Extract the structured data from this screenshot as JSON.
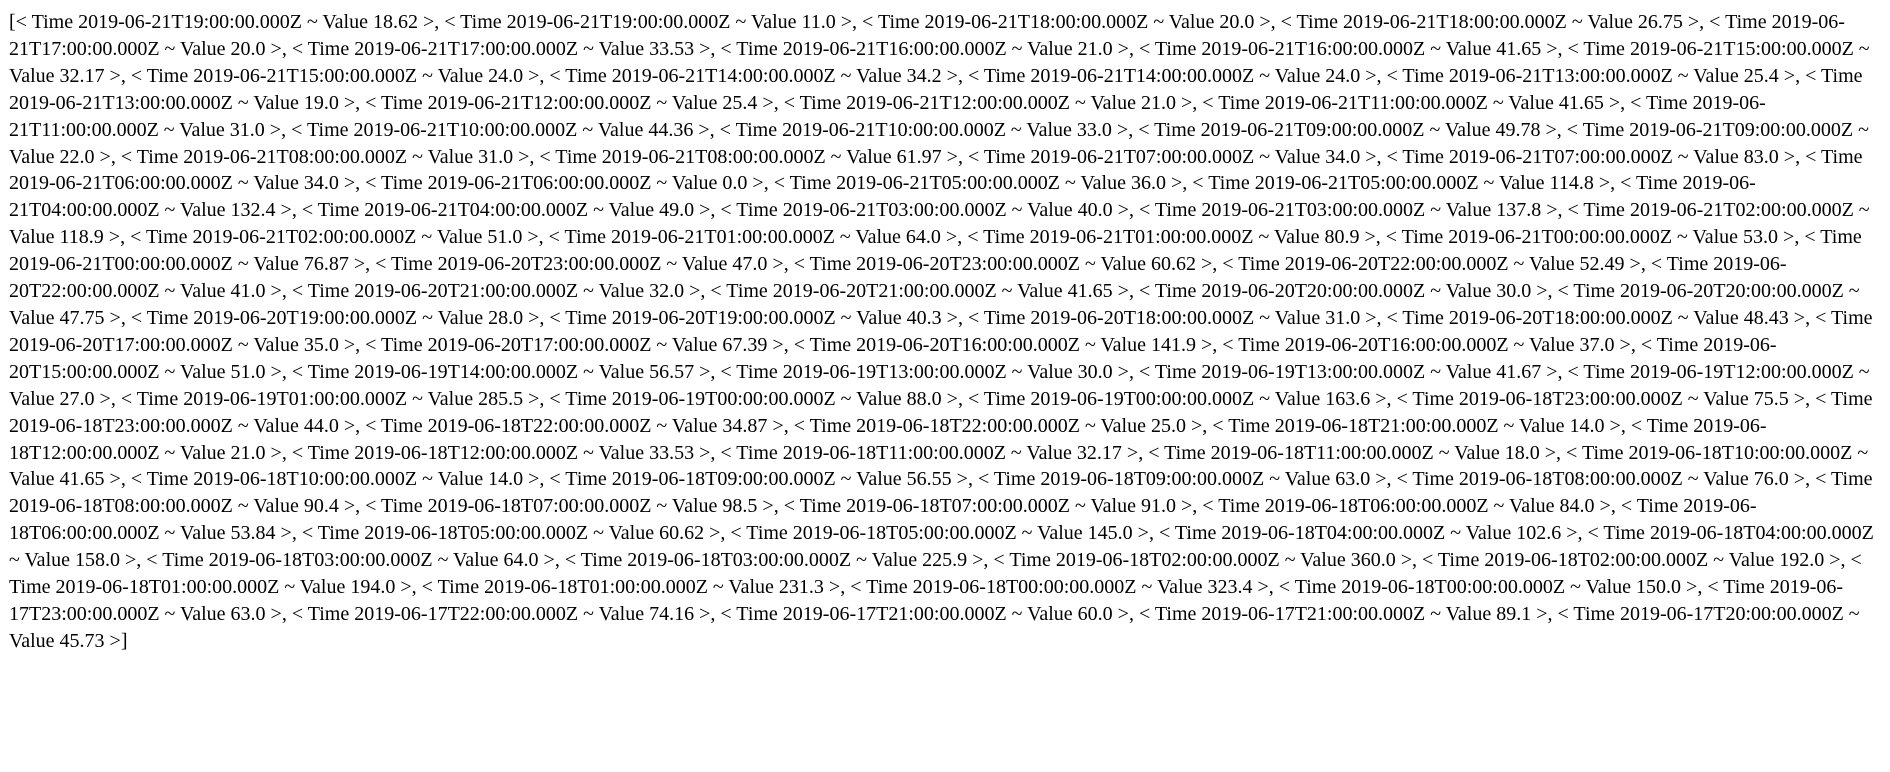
{
  "document": {
    "content": "[< Time 2019-06-21T19:00:00.000Z ~ Value 18.62 >, < Time 2019-06-21T19:00:00.000Z ~ Value 11.0 >, < Time 2019-06-21T18:00:00.000Z ~ Value 20.0 >, < Time 2019-06-21T18:00:00.000Z ~ Value 26.75 >, < Time 2019-06-21T17:00:00.000Z ~ Value 20.0 >, < Time 2019-06-21T17:00:00.000Z ~ Value 33.53 >, < Time 2019-06-21T16:00:00.000Z ~ Value 21.0 >, < Time 2019-06-21T16:00:00.000Z ~ Value 41.65 >, < Time 2019-06-21T15:00:00.000Z ~ Value 32.17 >, < Time 2019-06-21T15:00:00.000Z ~ Value 24.0 >, < Time 2019-06-21T14:00:00.000Z ~ Value 34.2 >, < Time 2019-06-21T14:00:00.000Z ~ Value 24.0 >, < Time 2019-06-21T13:00:00.000Z ~ Value 25.4 >, < Time 2019-06-21T13:00:00.000Z ~ Value 19.0 >, < Time 2019-06-21T12:00:00.000Z ~ Value 25.4 >, < Time 2019-06-21T12:00:00.000Z ~ Value 21.0 >, < Time 2019-06-21T11:00:00.000Z ~ Value 41.65 >, < Time 2019-06-21T11:00:00.000Z ~ Value 31.0 >, < Time 2019-06-21T10:00:00.000Z ~ Value 44.36 >, < Time 2019-06-21T10:00:00.000Z ~ Value 33.0 >, < Time 2019-06-21T09:00:00.000Z ~ Value 49.78 >, < Time 2019-06-21T09:00:00.000Z ~ Value 22.0 >, < Time 2019-06-21T08:00:00.000Z ~ Value 31.0 >, < Time 2019-06-21T08:00:00.000Z ~ Value 61.97 >, < Time 2019-06-21T07:00:00.000Z ~ Value 34.0 >, < Time 2019-06-21T07:00:00.000Z ~ Value 83.0 >, < Time 2019-06-21T06:00:00.000Z ~ Value 34.0 >, < Time 2019-06-21T06:00:00.000Z ~ Value 0.0 >, < Time 2019-06-21T05:00:00.000Z ~ Value 36.0 >, < Time 2019-06-21T05:00:00.000Z ~ Value 114.8 >, < Time 2019-06-21T04:00:00.000Z ~ Value 132.4 >, < Time 2019-06-21T04:00:00.000Z ~ Value 49.0 >, < Time 2019-06-21T03:00:00.000Z ~ Value 40.0 >, < Time 2019-06-21T03:00:00.000Z ~ Value 137.8 >, < Time 2019-06-21T02:00:00.000Z ~ Value 118.9 >, < Time 2019-06-21T02:00:00.000Z ~ Value 51.0 >, < Time 2019-06-21T01:00:00.000Z ~ Value 64.0 >, < Time 2019-06-21T01:00:00.000Z ~ Value 80.9 >, < Time 2019-06-21T00:00:00.000Z ~ Value 53.0 >, < Time 2019-06-21T00:00:00.000Z ~ Value 76.87 >, < Time 2019-06-20T23:00:00.000Z ~ Value 47.0 >, < Time 2019-06-20T23:00:00.000Z ~ Value 60.62 >, < Time 2019-06-20T22:00:00.000Z ~ Value 52.49 >, < Time 2019-06-20T22:00:00.000Z ~ Value 41.0 >, < Time 2019-06-20T21:00:00.000Z ~ Value 32.0 >, < Time 2019-06-20T21:00:00.000Z ~ Value 41.65 >, < Time 2019-06-20T20:00:00.000Z ~ Value 30.0 >, < Time 2019-06-20T20:00:00.000Z ~ Value 47.75 >, < Time 2019-06-20T19:00:00.000Z ~ Value 28.0 >, < Time 2019-06-20T19:00:00.000Z ~ Value 40.3 >, < Time 2019-06-20T18:00:00.000Z ~ Value 31.0 >, < Time 2019-06-20T18:00:00.000Z ~ Value 48.43 >, < Time 2019-06-20T17:00:00.000Z ~ Value 35.0 >, < Time 2019-06-20T17:00:00.000Z ~ Value 67.39 >, < Time 2019-06-20T16:00:00.000Z ~ Value 141.9 >, < Time 2019-06-20T16:00:00.000Z ~ Value 37.0 >, < Time 2019-06-20T15:00:00.000Z ~ Value 51.0 >, < Time 2019-06-19T14:00:00.000Z ~ Value 56.57 >, < Time 2019-06-19T13:00:00.000Z ~ Value 30.0 >, < Time 2019-06-19T13:00:00.000Z ~ Value 41.67 >, < Time 2019-06-19T12:00:00.000Z ~ Value 27.0 >, < Time 2019-06-19T01:00:00.000Z ~ Value 285.5 >, < Time 2019-06-19T00:00:00.000Z ~ Value 88.0 >, < Time 2019-06-19T00:00:00.000Z ~ Value 163.6 >, < Time 2019-06-18T23:00:00.000Z ~ Value 75.5 >, < Time 2019-06-18T23:00:00.000Z ~ Value 44.0 >, < Time 2019-06-18T22:00:00.000Z ~ Value 34.87 >, < Time 2019-06-18T22:00:00.000Z ~ Value 25.0 >, < Time 2019-06-18T21:00:00.000Z ~ Value 14.0 >, < Time 2019-06-18T12:00:00.000Z ~ Value 21.0 >, < Time 2019-06-18T12:00:00.000Z ~ Value 33.53 >, < Time 2019-06-18T11:00:00.000Z ~ Value 32.17 >, < Time 2019-06-18T11:00:00.000Z ~ Value 18.0 >, < Time 2019-06-18T10:00:00.000Z ~ Value 41.65 >, < Time 2019-06-18T10:00:00.000Z ~ Value 14.0 >, < Time 2019-06-18T09:00:00.000Z ~ Value 56.55 >, < Time 2019-06-18T09:00:00.000Z ~ Value 63.0 >, < Time 2019-06-18T08:00:00.000Z ~ Value 76.0 >, < Time 2019-06-18T08:00:00.000Z ~ Value 90.4 >, < Time 2019-06-18T07:00:00.000Z ~ Value 98.5 >, < Time 2019-06-18T07:00:00.000Z ~ Value 91.0 >, < Time 2019-06-18T06:00:00.000Z ~ Value 84.0 >, < Time 2019-06-18T06:00:00.000Z ~ Value 53.84 >, < Time 2019-06-18T05:00:00.000Z ~ Value 60.62 >, < Time 2019-06-18T05:00:00.000Z ~ Value 145.0 >, < Time 2019-06-18T04:00:00.000Z ~ Value 102.6 >, < Time 2019-06-18T04:00:00.000Z ~ Value 158.0 >, < Time 2019-06-18T03:00:00.000Z ~ Value 64.0 >, < Time 2019-06-18T03:00:00.000Z ~ Value 225.9 >, < Time 2019-06-18T02:00:00.000Z ~ Value 360.0 >, < Time 2019-06-18T02:00:00.000Z ~ Value 192.0 >, < Time 2019-06-18T01:00:00.000Z ~ Value 194.0 >, < Time 2019-06-18T01:00:00.000Z ~ Value 231.3 >, < Time 2019-06-18T00:00:00.000Z ~ Value 323.4 >, < Time 2019-06-18T00:00:00.000Z ~ Value 150.0 >, < Time 2019-06-17T23:00:00.000Z ~ Value 63.0 >, < Time 2019-06-17T22:00:00.000Z ~ Value 74.16 >, < Time 2019-06-17T21:00:00.000Z ~ Value 60.0 >, < Time 2019-06-17T21:00:00.000Z ~ Value 89.1 >, < Time 2019-06-17T20:00:00.000Z ~ Value 45.73 >]"
  }
}
